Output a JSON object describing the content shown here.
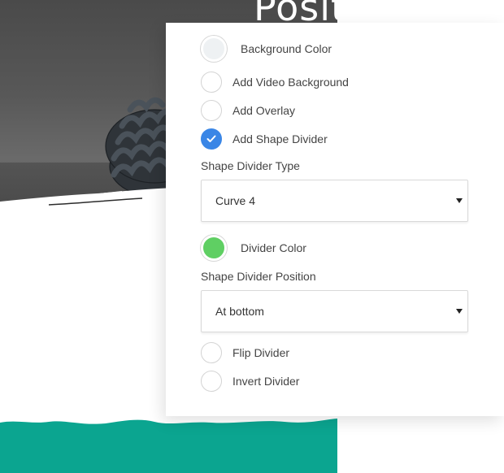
{
  "hero": {
    "title": "Posit"
  },
  "panel": {
    "background_color": {
      "label": "Background Color",
      "color": "#eef1f3"
    },
    "options_top": [
      {
        "label": "Add Video Background",
        "checked": false
      },
      {
        "label": "Add Overlay",
        "checked": false
      },
      {
        "label": "Add Shape Divider",
        "checked": true
      }
    ],
    "shape_divider_type": {
      "label": "Shape Divider Type",
      "value": "Curve 4"
    },
    "divider_color": {
      "label": "Divider Color",
      "color": "#5fcf63"
    },
    "shape_divider_position": {
      "label": "Shape Divider Position",
      "value": "At bottom"
    },
    "options_bottom": [
      {
        "label": "Flip Divider",
        "checked": false
      },
      {
        "label": "Invert Divider",
        "checked": false
      }
    ]
  },
  "colors": {
    "accent": "#3a86e6",
    "teal": "#0ba590"
  }
}
